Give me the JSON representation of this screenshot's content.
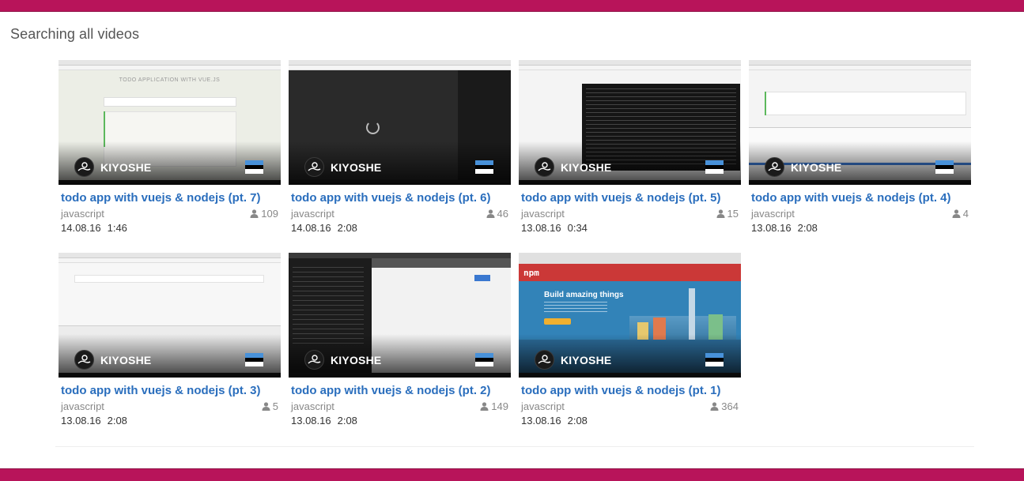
{
  "page": {
    "heading": "Searching all videos"
  },
  "colors": {
    "brand": "#b8145a",
    "link": "#2a6ebd",
    "flag_top": "#4891d9",
    "flag_mid": "#000000",
    "flag_bot": "#ffffff"
  },
  "videos": [
    {
      "title": "todo app with vuejs & nodejs (pt. 7)",
      "channel": "KIYOSHE",
      "tag": "javascript",
      "views": "109",
      "date": "14.08.16",
      "duration": "1:46",
      "theme": "light-app"
    },
    {
      "title": "todo app with vuejs & nodejs (pt. 6)",
      "channel": "KIYOSHE",
      "tag": "javascript",
      "views": "46",
      "date": "14.08.16",
      "duration": "2:08",
      "theme": "dark-loading"
    },
    {
      "title": "todo app with vuejs & nodejs (pt. 5)",
      "channel": "KIYOSHE",
      "tag": "javascript",
      "views": "15",
      "date": "13.08.16",
      "duration": "0:34",
      "theme": "terminal"
    },
    {
      "title": "todo app with vuejs & nodejs (pt. 4)",
      "channel": "KIYOSHE",
      "tag": "javascript",
      "views": "4",
      "date": "13.08.16",
      "duration": "2:08",
      "theme": "devtools"
    },
    {
      "title": "todo app with vuejs & nodejs (pt. 3)",
      "channel": "KIYOSHE",
      "tag": "javascript",
      "views": "5",
      "date": "13.08.16",
      "duration": "2:08",
      "theme": "blank-devtools"
    },
    {
      "title": "todo app with vuejs & nodejs (pt. 2)",
      "channel": "KIYOSHE",
      "tag": "javascript",
      "views": "149",
      "date": "13.08.16",
      "duration": "2:08",
      "theme": "split"
    },
    {
      "title": "todo app with vuejs & nodejs (pt. 1)",
      "channel": "KIYOSHE",
      "tag": "javascript",
      "views": "364",
      "date": "13.08.16",
      "duration": "2:08",
      "theme": "npm"
    }
  ],
  "npm": {
    "logo": "npm",
    "headline": "Build amazing things"
  }
}
